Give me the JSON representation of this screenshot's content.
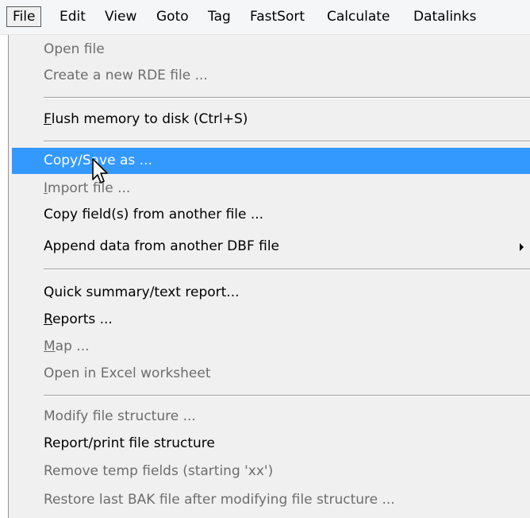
{
  "menubar": {
    "items": [
      {
        "label": "File",
        "active": true
      },
      {
        "label": "Edit"
      },
      {
        "label": "View"
      },
      {
        "label": "Goto"
      },
      {
        "label": "Tag"
      },
      {
        "label": "FastSort"
      },
      {
        "label": "Calculate"
      },
      {
        "label": "Datalinks"
      }
    ]
  },
  "file_menu": {
    "open_file": "Open file",
    "create_rde": "Create a new RDE file ...",
    "flush_hotkey": "F",
    "flush_rest": "lush memory to disk (Ctrl+S)",
    "copy_save_as": "Copy/Save as ...",
    "import_hotkey": "I",
    "import_rest": "mport file ...",
    "copy_fields": "Copy field(s) from another file ...",
    "append_data": "Append data from another DBF file",
    "quick_summary": "Quick summary/text report...",
    "reports_hotkey": "R",
    "reports_rest": "eports ...",
    "map_hotkey": "M",
    "map_rest": "ap ...",
    "open_excel": "Open in Excel worksheet",
    "modify_structure": "Modify file structure ...",
    "report_structure": "Report/print file structure",
    "remove_temp": "Remove temp fields (starting 'xx')",
    "restore_bak": "Restore last BAK file after modifying file structure ..."
  },
  "colors": {
    "highlight": "#3399ff",
    "menu_background": "#f0f0f0",
    "disabled_text": "#6d6d6d"
  },
  "icons": {
    "cursor": "arrow-cursor-icon",
    "submenu": "chevron-right-icon"
  }
}
